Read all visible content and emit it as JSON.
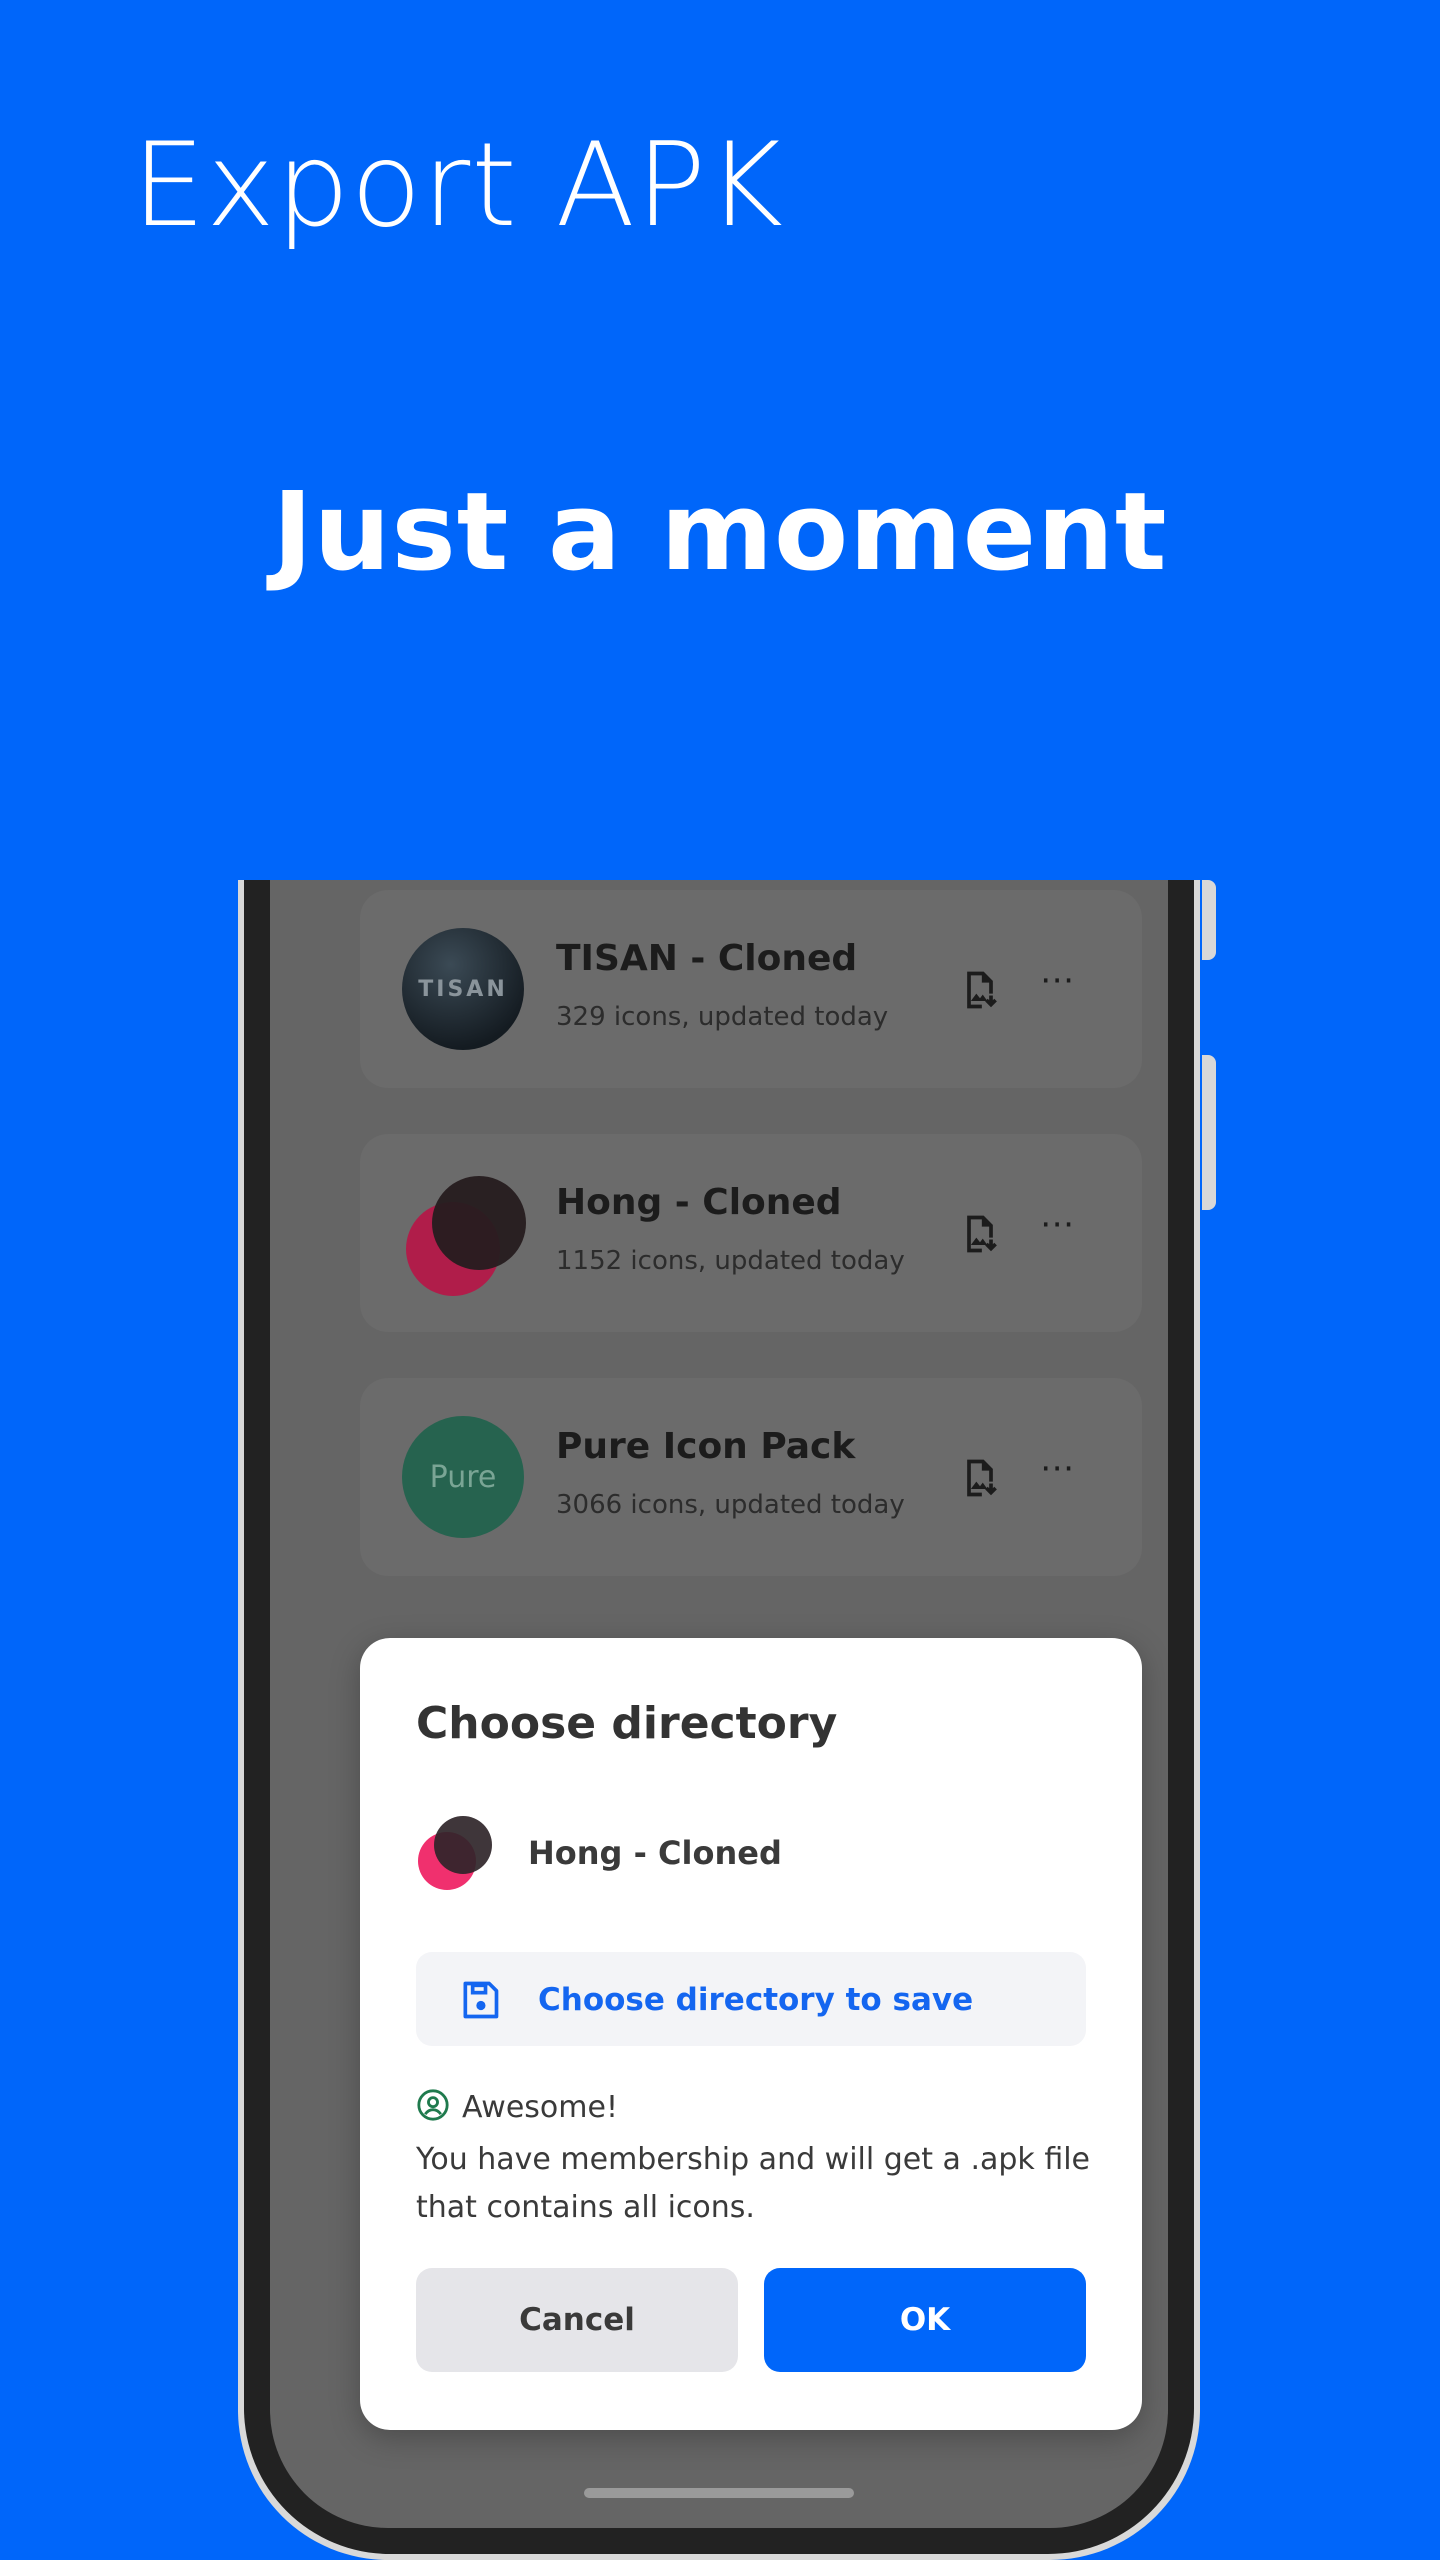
{
  "header": {
    "title": "Export APK"
  },
  "tagline": "Just a moment",
  "packs": [
    {
      "name": "TISAN - Cloned",
      "meta": "329 icons, updated today",
      "avatar_text": "TISAN",
      "avatar": "tisan-logo-icon"
    },
    {
      "name": "Hong - Cloned",
      "meta": "1152 icons, updated today",
      "avatar": "hong-logo-icon"
    },
    {
      "name": "Pure Icon Pack",
      "meta": "3066 icons, updated today",
      "avatar_text": "Pure",
      "avatar": "pure-logo-icon"
    }
  ],
  "dialog": {
    "title": "Choose directory",
    "pack_name": "Hong - Cloned",
    "choose_dir_label": "Choose directory to save",
    "status_title": "Awesome!",
    "status_message": "You have membership and will get a .apk file that contains all icons.",
    "cancel_label": "Cancel",
    "ok_label": "OK"
  },
  "colors": {
    "background": "#0066fa",
    "accent": "#1466f0",
    "success": "#1f7a4d"
  }
}
